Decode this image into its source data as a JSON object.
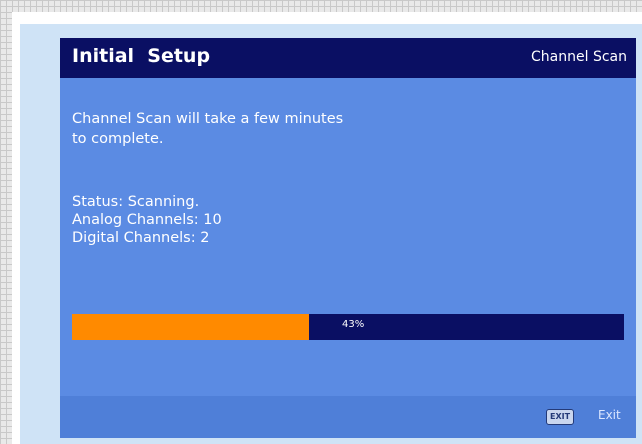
{
  "header": {
    "title": "Initial  Setup",
    "section": "Channel Scan"
  },
  "message": "Channel Scan will take a few minutes\nto complete.",
  "status": {
    "status_line": "Status: Scanning.",
    "analog_line": "Analog Channels: 10",
    "digital_line": "Digital Channels: 2"
  },
  "progress": {
    "percent": 43,
    "label": "43%"
  },
  "footer": {
    "exit_key": "EXIT",
    "exit_label": "Exit"
  },
  "colors": {
    "title_bar": "#0a0f63",
    "screen_bg": "#5b8be3",
    "progress_fill": "#ff8a00",
    "progress_track": "#0a0f63"
  }
}
